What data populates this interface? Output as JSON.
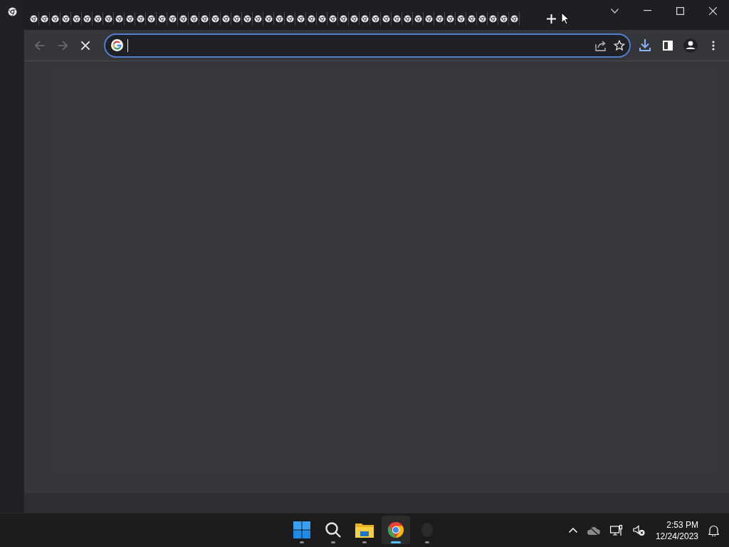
{
  "tabs": [
    {
      "selected": false
    },
    {
      "selected": false
    },
    {
      "selected": false
    },
    {
      "selected": false
    },
    {
      "selected": false
    },
    {
      "selected": false
    },
    {
      "selected": false
    },
    {
      "selected": false
    },
    {
      "selected": false
    },
    {
      "selected": false
    },
    {
      "selected": false
    },
    {
      "selected": false
    },
    {
      "selected": false
    },
    {
      "selected": false
    },
    {
      "selected": false
    },
    {
      "selected": false
    },
    {
      "selected": false
    },
    {
      "selected": false
    },
    {
      "selected": false
    },
    {
      "selected": false
    },
    {
      "selected": false
    },
    {
      "selected": false
    },
    {
      "selected": false
    },
    {
      "selected": false
    },
    {
      "selected": false
    },
    {
      "selected": false
    },
    {
      "selected": false
    },
    {
      "selected": false
    },
    {
      "selected": false
    },
    {
      "selected": false
    },
    {
      "selected": false
    },
    {
      "selected": false
    },
    {
      "selected": false
    },
    {
      "selected": false
    },
    {
      "selected": false
    },
    {
      "selected": false
    },
    {
      "selected": false
    },
    {
      "selected": false
    },
    {
      "selected": false
    },
    {
      "selected": false
    },
    {
      "selected": false
    },
    {
      "selected": false
    },
    {
      "selected": false
    },
    {
      "selected": false
    },
    {
      "selected": false
    },
    {
      "selected": false
    }
  ],
  "taskbar": {
    "apps": [
      {
        "kind": "start",
        "selected": false
      },
      {
        "kind": "search",
        "selected": false
      },
      {
        "kind": "files",
        "selected": false
      },
      {
        "kind": "browser",
        "selected": true
      },
      {
        "kind": "app",
        "selected": false
      }
    ],
    "time": "2:53 PM",
    "date": "12/24/2023"
  }
}
